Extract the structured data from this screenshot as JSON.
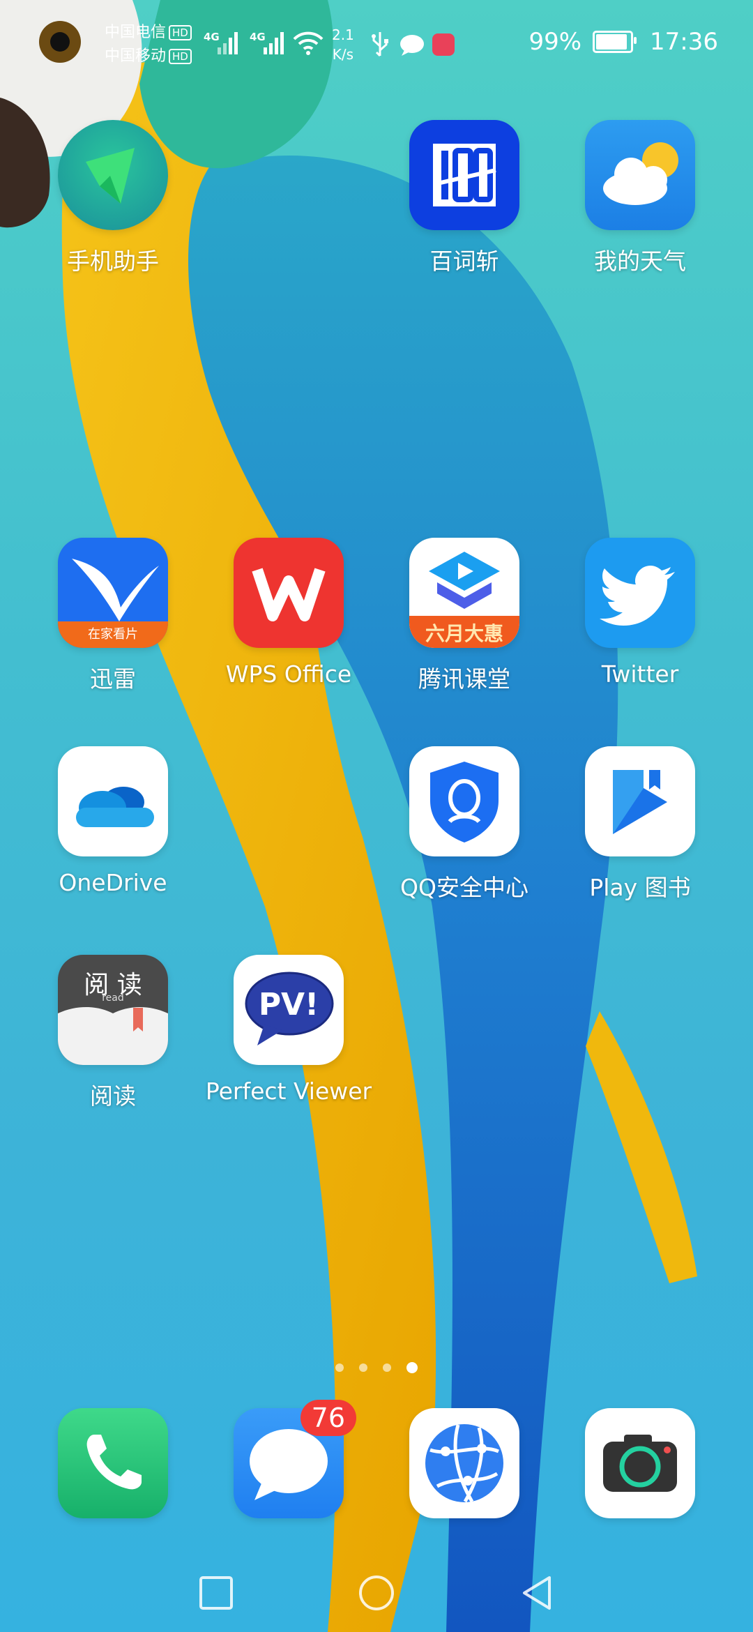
{
  "status_bar": {
    "carrier1": "中国电信",
    "carrier2": "中国移动",
    "hd": "HD",
    "net1": "4G",
    "net2": "4G",
    "speed_value": "2.1",
    "speed_unit": "K/s",
    "battery": "99%",
    "battery_level": 0.99,
    "time": "17:36"
  },
  "apps": [
    {
      "label": "手机助手",
      "icon": "phone-assistant-icon"
    },
    {
      "label": "百词斩",
      "icon": "baicizhan-icon"
    },
    {
      "label": "我的天气",
      "icon": "weather-icon"
    },
    {
      "label": "迅雷",
      "icon": "xunlei-icon",
      "banner": "在家看片"
    },
    {
      "label": "WPS Office",
      "icon": "wps-icon"
    },
    {
      "label": "腾讯课堂",
      "icon": "tencent-classroom-icon",
      "banner": "六月大惠"
    },
    {
      "label": "Twitter",
      "icon": "twitter-icon"
    },
    {
      "label": "OneDrive",
      "icon": "onedrive-icon"
    },
    {
      "label": "QQ安全中心",
      "icon": "qq-security-icon"
    },
    {
      "label": "Play 图书",
      "icon": "play-books-icon"
    },
    {
      "label": "阅读",
      "icon": "reader-icon",
      "icon_text": "阅 读",
      "icon_sub": "read"
    },
    {
      "label": "Perfect Viewer",
      "icon": "perfect-viewer-icon",
      "icon_text": "PV!"
    }
  ],
  "dock": [
    {
      "name": "phone",
      "icon": "phone-icon"
    },
    {
      "name": "messages",
      "icon": "messages-icon",
      "badge": "76"
    },
    {
      "name": "browser",
      "icon": "browser-icon"
    },
    {
      "name": "camera",
      "icon": "camera-icon"
    }
  ],
  "page_indicator": {
    "count": 4,
    "active": 4
  },
  "nav": [
    "recents",
    "home",
    "back"
  ],
  "colors": {
    "accent": "#35b2e0",
    "badge": "#f23a36"
  }
}
